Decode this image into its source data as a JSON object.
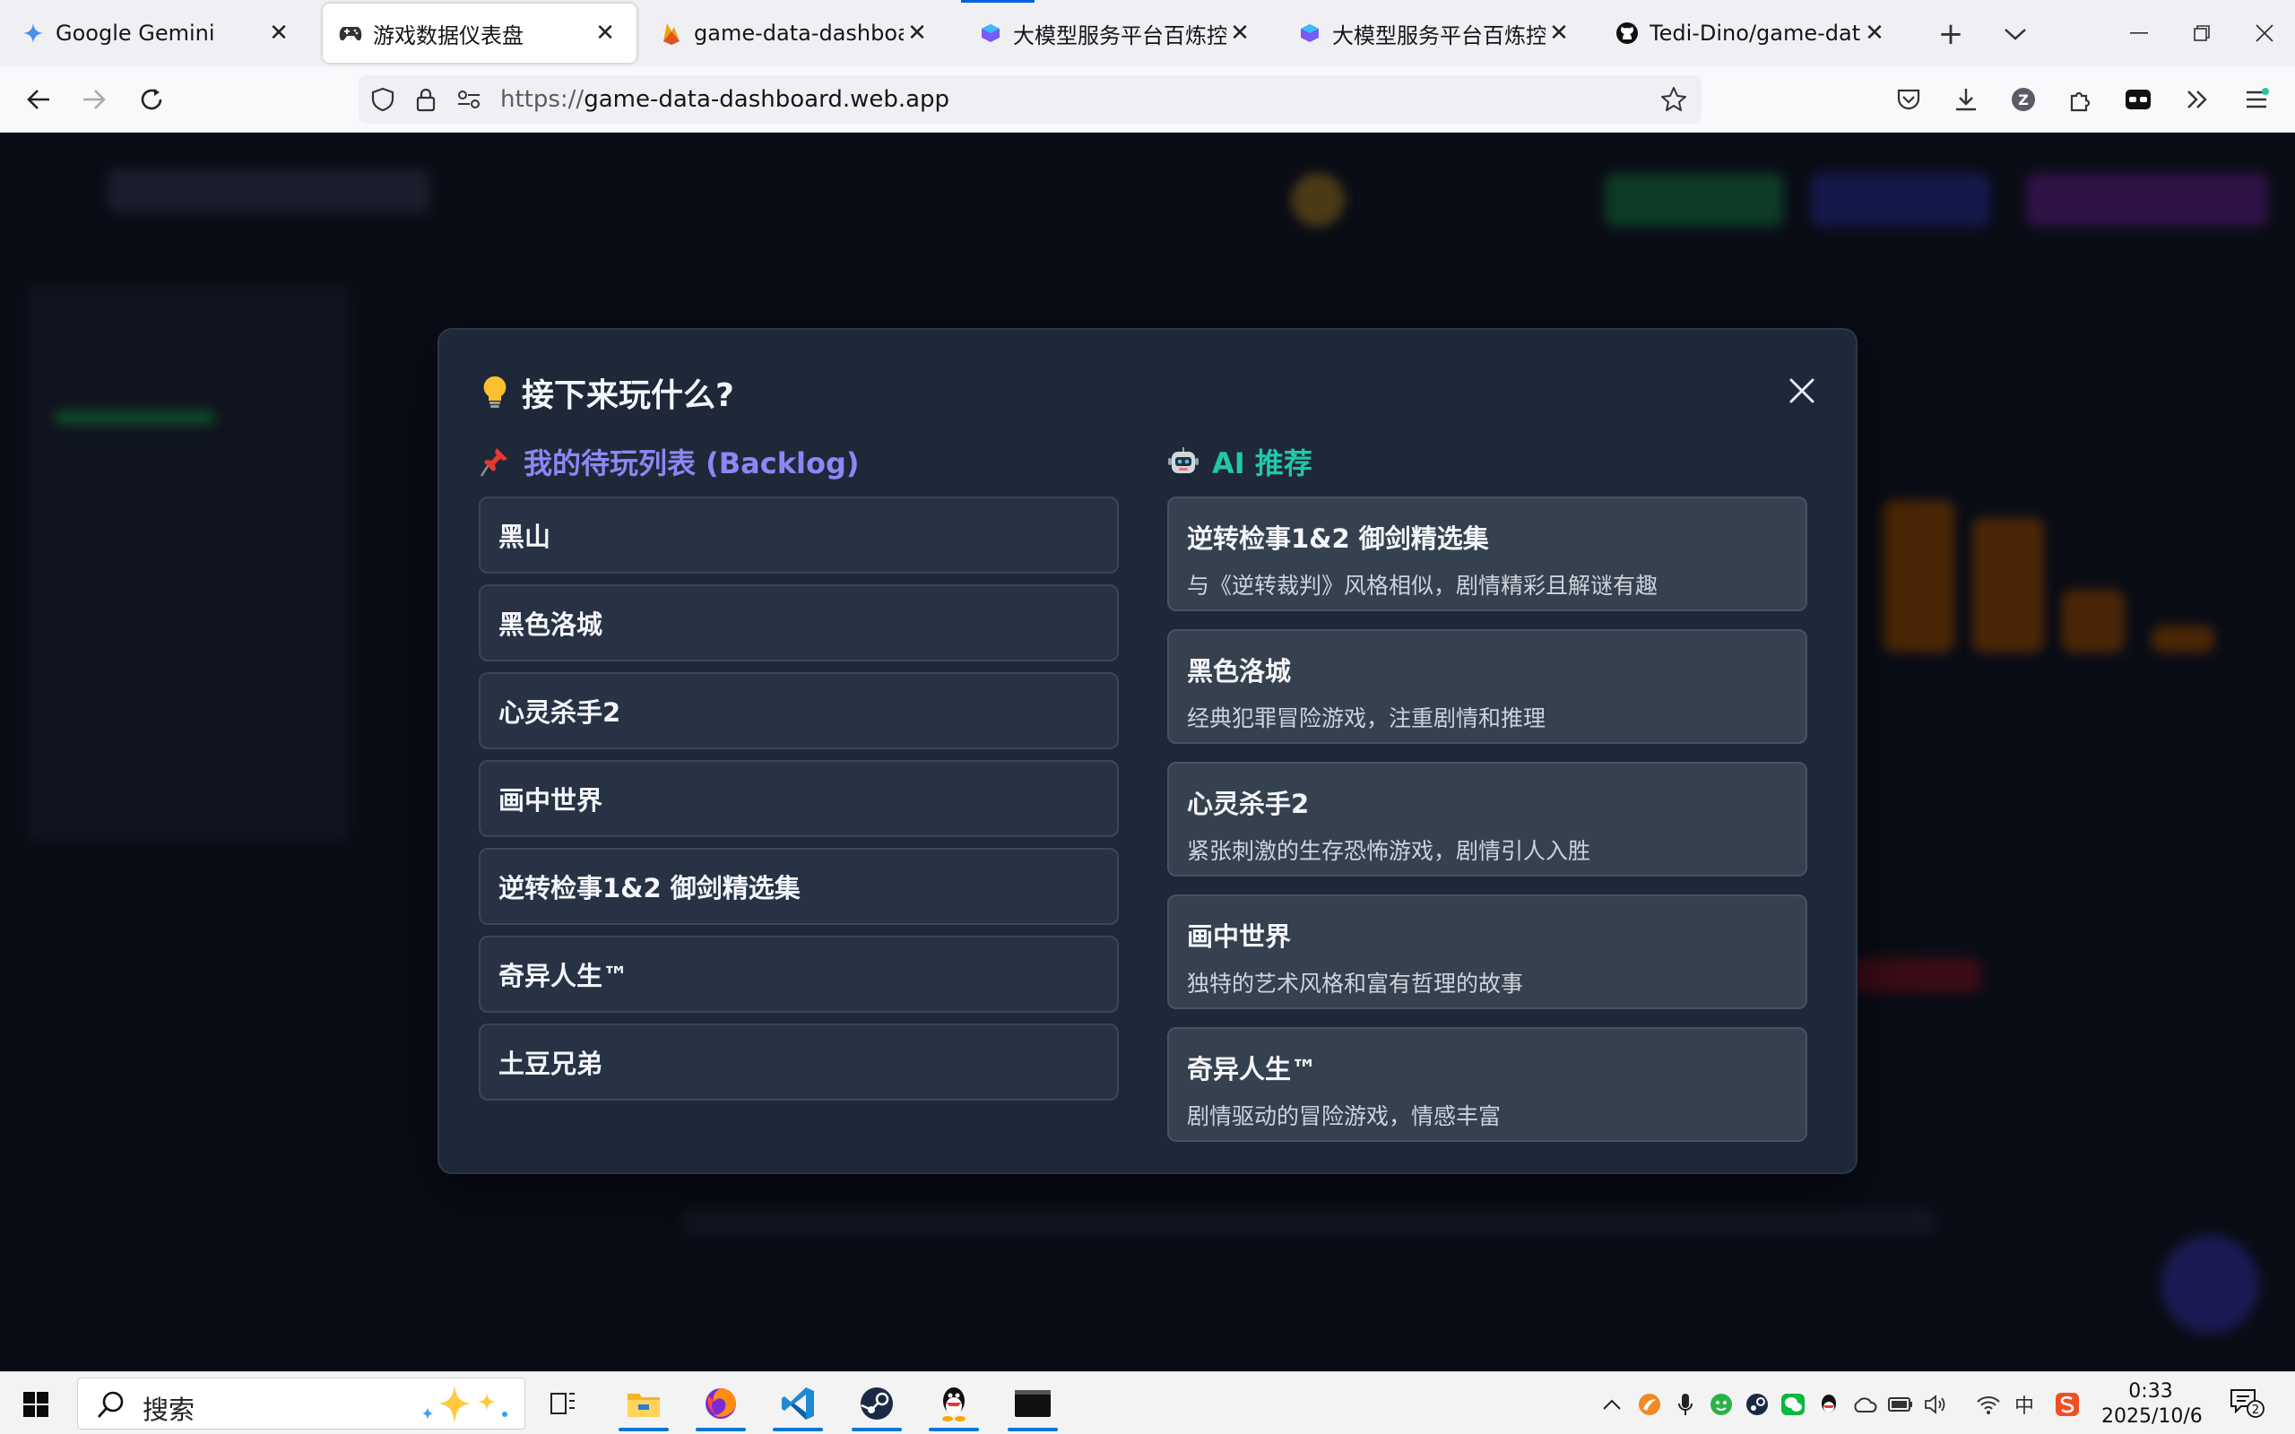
{
  "browser": {
    "tabs": [
      {
        "title": "Google Gemini",
        "icon": "gemini-icon"
      },
      {
        "title": "游戏数据仪表盘",
        "icon": "gamepad-icon"
      },
      {
        "title": "game-data-dashboard - ",
        "icon": "firebase-icon"
      },
      {
        "title": "大模型服务平台百炼控制台",
        "icon": "bailian-icon"
      },
      {
        "title": "大模型服务平台百炼控制台",
        "icon": "bailian-icon"
      },
      {
        "title": "Tedi-Dino/game-data-da",
        "icon": "github-icon"
      }
    ],
    "url_scheme": "https://",
    "url_host": "game-data-dashboard.web.app",
    "profile_initial": "Z"
  },
  "modal": {
    "title": "接下来玩什么?",
    "title_icon": "lightbulb-icon",
    "backlog_title": "我的待玩列表 (Backlog)",
    "backlog_icon": "pushpin-icon",
    "backlog_color": "#8b87f5",
    "backlog": [
      "黑山",
      "黑色洛城",
      "心灵杀手2",
      "画中世界",
      "逆转检事1&2 御剑精选集",
      "奇异人生™",
      "土豆兄弟"
    ],
    "ai_title": "AI 推荐",
    "ai_icon": "robot-icon",
    "ai_color": "#22c7a9",
    "ai": [
      {
        "name": "逆转检事1&2 御剑精选集",
        "desc": "与《逆转裁判》风格相似，剧情精彩且解谜有趣"
      },
      {
        "name": "黑色洛城",
        "desc": "经典犯罪冒险游戏，注重剧情和推理"
      },
      {
        "name": "心灵杀手2",
        "desc": "紧张刺激的生存恐怖游戏，剧情引人入胜"
      },
      {
        "name": "画中世界",
        "desc": "独特的艺术风格和富有哲理的故事"
      },
      {
        "name": "奇异人生™",
        "desc": "剧情驱动的冒险游戏，情感丰富"
      }
    ]
  },
  "taskbar": {
    "search_label": "搜索",
    "time": "0:33",
    "date": "2025/10/6",
    "ime": "中",
    "notification_count": "2"
  }
}
